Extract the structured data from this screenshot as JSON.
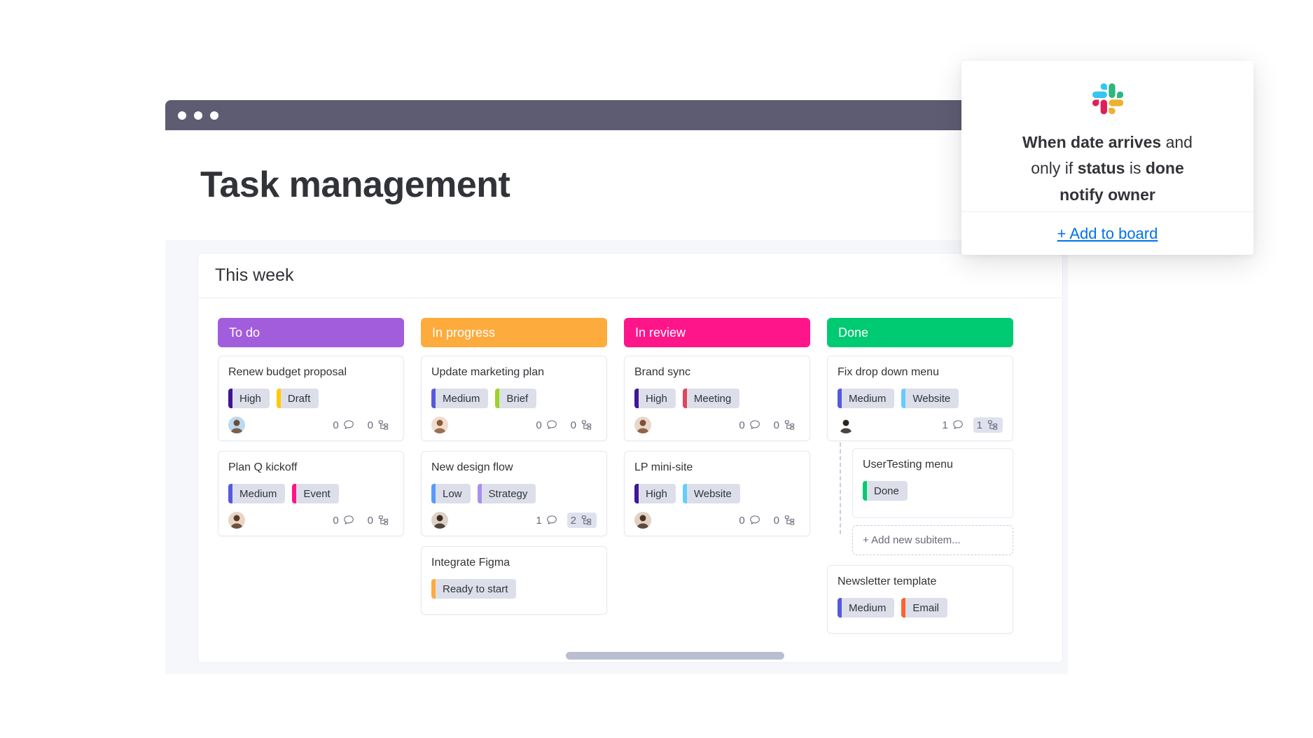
{
  "window": {
    "dots": [
      "close-dot",
      "minimize-dot",
      "maximize-dot"
    ]
  },
  "page": {
    "title": "Task management"
  },
  "board": {
    "heading": "This  week",
    "columns": [
      {
        "label": "To do",
        "color": "#a25ddc",
        "tasks": [
          {
            "title": "Renew budget proposal",
            "tags": [
              {
                "label": "High",
                "color": "#401694"
              },
              {
                "label": "Draft",
                "color": "#ffcb00"
              }
            ],
            "avatar_skin": "#6f4a33",
            "avatar_bg": "#bcd9ef",
            "comments": "0",
            "subitems": "1",
            "subitems_count_label": "0",
            "comments_highlight": false,
            "subitems_highlight": false
          },
          {
            "title": "Plan Q kickoff",
            "tags": [
              {
                "label": "Medium",
                "color": "#5559df"
              },
              {
                "label": "Event",
                "color": "#ff158a"
              }
            ],
            "avatar_skin": "#5b3a26",
            "avatar_bg": "#e7d6c8",
            "comments": "0",
            "subitems_count_label": "0",
            "comments_highlight": false,
            "subitems_highlight": false
          }
        ]
      },
      {
        "label": "In progress",
        "color": "#fdab3d",
        "tasks": [
          {
            "title": "Update marketing plan",
            "tags": [
              {
                "label": "Medium",
                "color": "#5559df"
              },
              {
                "label": "Brief",
                "color": "#9cd326"
              }
            ],
            "avatar_skin": "#8a5a3b",
            "avatar_bg": "#f0ddd0",
            "comments": "0",
            "subitems_count_label": "0",
            "comments_highlight": false,
            "subitems_highlight": false
          },
          {
            "title": "New design flow",
            "tags": [
              {
                "label": "Low",
                "color": "#579bfc"
              },
              {
                "label": "Strategy",
                "color": "#a98fee"
              }
            ],
            "avatar_skin": "#3b2a20",
            "avatar_bg": "#ded2c7",
            "comments": "1",
            "subitems_count_label": "2",
            "comments_highlight": false,
            "subitems_highlight": true
          },
          {
            "title": "Integrate Figma",
            "tags": [
              {
                "label": "Ready to start",
                "color": "#fdab3d"
              }
            ],
            "hide_footer": true
          }
        ]
      },
      {
        "label": "In review",
        "color": "#ff158a",
        "tasks": [
          {
            "title": "Brand sync",
            "tags": [
              {
                "label": "High",
                "color": "#401694"
              },
              {
                "label": "Meeting",
                "color": "#e2445c"
              }
            ],
            "avatar_skin": "#7b5135",
            "avatar_bg": "#e9d8c9",
            "comments": "0",
            "subitems_count_label": "0",
            "comments_highlight": false,
            "subitems_highlight": false
          },
          {
            "title": "LP mini-site",
            "tags": [
              {
                "label": "High",
                "color": "#401694"
              },
              {
                "label": "Website",
                "color": "#66ccff"
              }
            ],
            "avatar_skin": "#4a3226",
            "avatar_bg": "#e3d2c3",
            "comments": "0",
            "subitems_count_label": "0",
            "comments_highlight": false,
            "subitems_highlight": false
          }
        ]
      },
      {
        "label": "Done",
        "color": "#00ca72",
        "tasks": [
          {
            "title": "Fix drop down menu",
            "tags": [
              {
                "label": "Medium",
                "color": "#5559df"
              },
              {
                "label": "Website",
                "color": "#66ccff"
              }
            ],
            "avatar_skin": "#2e2320",
            "avatar_bg": "#ffffff",
            "comments": "1",
            "subitems_count_label": "1",
            "comments_highlight": false,
            "subitems_highlight": true,
            "subitems_group": {
              "items": [
                {
                  "title": "UserTesting menu",
                  "tags": [
                    {
                      "label": "Done",
                      "color": "#00ca72"
                    }
                  ]
                }
              ],
              "add_label": "+ Add new subitem..."
            }
          },
          {
            "title": "Newsletter template",
            "tags": [
              {
                "label": "Medium",
                "color": "#5559df"
              },
              {
                "label": "Email",
                "color": "#fb642f"
              }
            ],
            "hide_footer": true
          }
        ]
      }
    ]
  },
  "popup": {
    "logo": "slack-icon",
    "recipe_parts": [
      {
        "text": "When date arrives",
        "bold": true
      },
      {
        "text": " and only if ",
        "bold": false
      },
      {
        "text": "status",
        "bold": true
      },
      {
        "text": " is ",
        "bold": false
      },
      {
        "text": "done",
        "bold": true
      },
      {
        "text": " notify owner",
        "bold": true
      }
    ],
    "recipe_line1_bold": "When date arrives",
    "recipe_line1_rest": " and",
    "recipe_line2_pre": "only if ",
    "recipe_line2_b1": "status",
    "recipe_line2_mid": " is ",
    "recipe_line2_b2": "done",
    "recipe_line3": "notify owner",
    "add_to_board": "+ Add to board",
    "accent_color": "#0073ea"
  },
  "colors": {
    "titlebar": "#5d5c72",
    "board_bg": "#f6f7fb",
    "tag_bg": "#dcdfea",
    "scrollbar": "#b9bed1"
  }
}
